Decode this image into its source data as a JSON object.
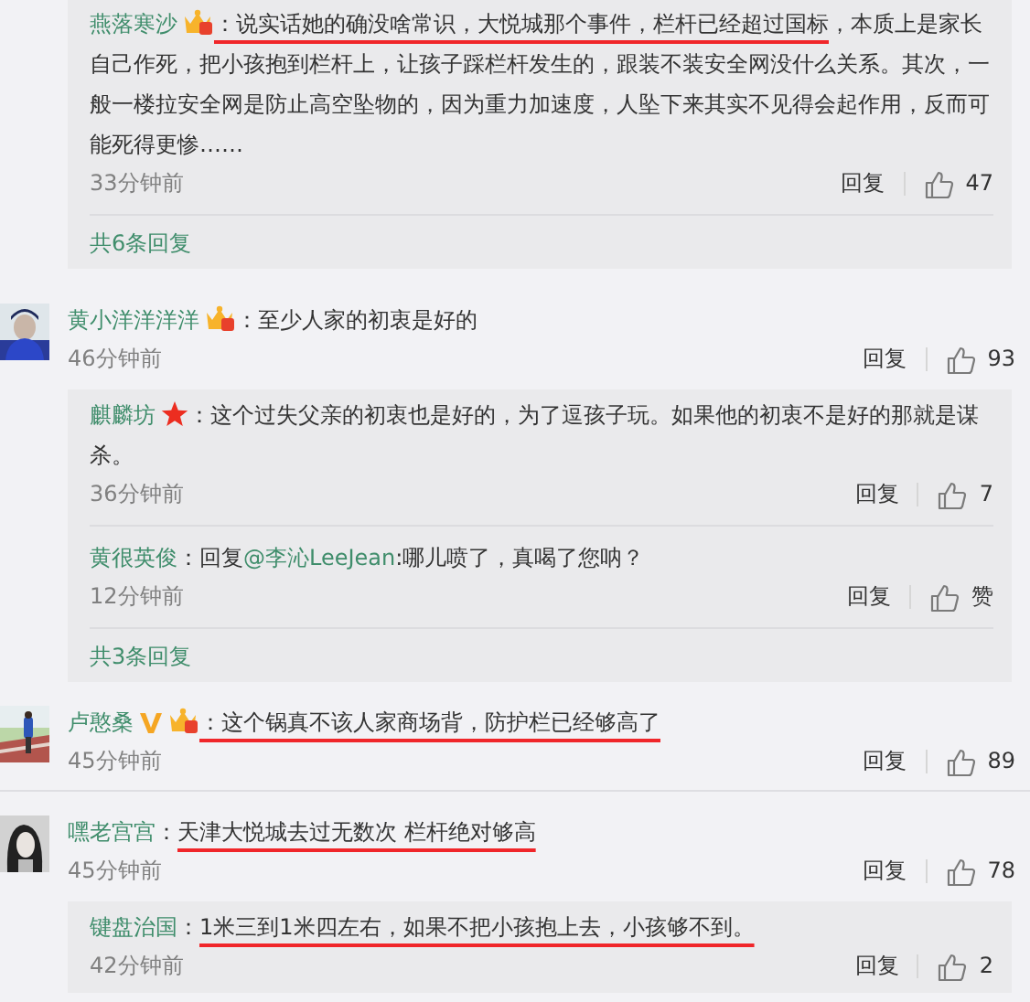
{
  "threads": [
    {
      "replies": [
        {
          "name": "燕落寒沙",
          "badges": [
            {
              "kind": "crown"
            }
          ],
          "segments": [
            {
              "text": "：说实话她的确没啥常识，大悦城那个事件，栏杆已经超过国标",
              "kind": "underlined"
            },
            {
              "text": "，本质上是家长自己作死，把小孩抱到栏杆上，让孩子踩栏杆发生的，跟装不装安全网没什么关系。其次，一般一楼拉安全网是防止高空坠物的，因为重力加速度，人坠下来其实不见得会起作用，反而可能死得更惨……",
              "kind": "plain"
            }
          ],
          "time": "33分钟前",
          "reply_label": "回复",
          "likes": "47"
        }
      ],
      "more_replies": "共6条回复"
    },
    {
      "comment": {
        "name": "黄小洋洋洋洋",
        "badges": [
          {
            "kind": "crown"
          }
        ],
        "segments": [
          {
            "text": "：至少人家的初衷是好的",
            "kind": "plain"
          }
        ],
        "time": "46分钟前",
        "reply_label": "回复",
        "likes": "93"
      },
      "replies": [
        {
          "name": "麒麟坊",
          "badges": [
            {
              "kind": "star"
            }
          ],
          "segments": [
            {
              "text": "：这个过失父亲的初衷也是好的，为了逗孩子玩。如果他的初衷不是好的那就是谋杀。",
              "kind": "plain"
            }
          ],
          "time": "36分钟前",
          "reply_label": "回复",
          "likes": "7"
        },
        {
          "name": "黄很英俊",
          "segments": [
            {
              "text": "：回复",
              "kind": "plain"
            },
            {
              "text": "@李沁LeeJean",
              "kind": "mention"
            },
            {
              "text": ":哪儿喷了，真喝了您呐？",
              "kind": "plain"
            }
          ],
          "time": "12分钟前",
          "reply_label": "回复",
          "likes": "赞"
        }
      ],
      "more_replies": "共3条回复"
    },
    {
      "comment": {
        "name": "卢憨桑",
        "badges": [
          {
            "kind": "verified"
          },
          {
            "kind": "crown"
          }
        ],
        "segments": [
          {
            "text": "：这个锅真不该人家商场背，防护栏已经够高了",
            "kind": "underlined"
          }
        ],
        "time": "45分钟前",
        "reply_label": "回复",
        "likes": "89"
      }
    },
    {
      "comment": {
        "name": "嘿老宫宫",
        "segments": [
          {
            "text": "：",
            "kind": "plain"
          },
          {
            "text": "天津大悦城去过无数次  栏杆绝对够高",
            "kind": "underlined"
          }
        ],
        "time": "45分钟前",
        "reply_label": "回复",
        "likes": "78"
      },
      "replies": [
        {
          "name": "键盘治国",
          "segments": [
            {
              "text": "：",
              "kind": "plain"
            },
            {
              "text": "1米三到1米四左右，如果不把小孩抱上去，小孩够不到。",
              "kind": "underlined"
            }
          ],
          "time": "42分钟前",
          "reply_label": "回复",
          "likes": "2"
        }
      ]
    }
  ]
}
